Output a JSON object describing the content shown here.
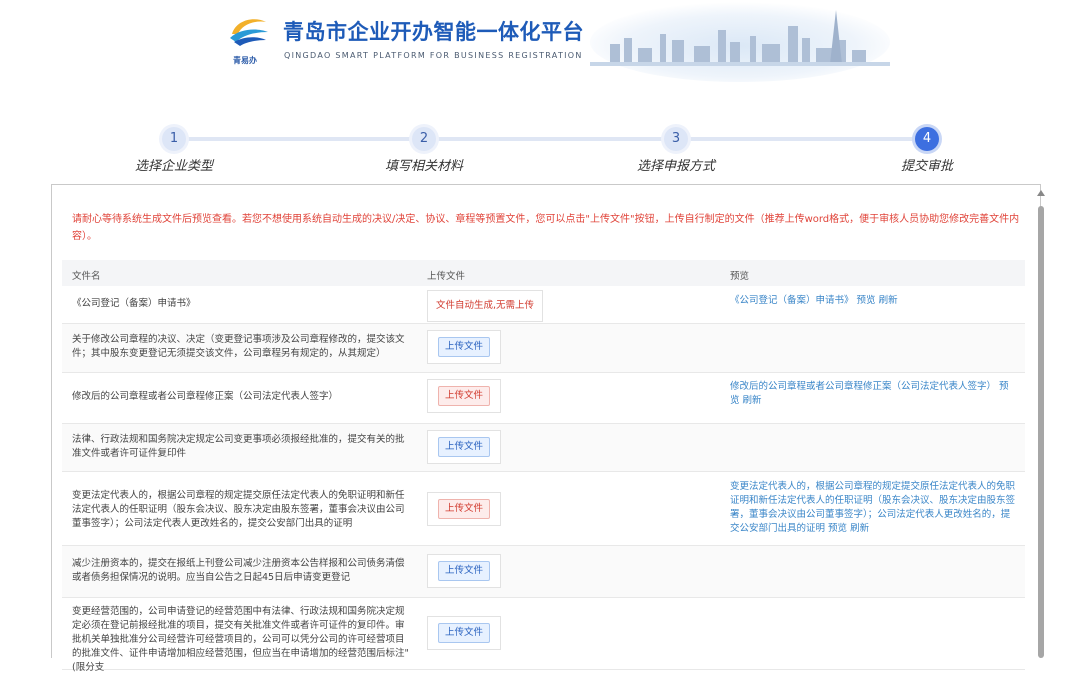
{
  "header": {
    "title": "青岛市企业开办智能一体化平台",
    "subtitle": "QINGDAO SMART PLATFORM FOR BUSINESS REGISTRATION",
    "logo_caption": "青易办",
    "brand_color": "#1e5bb8"
  },
  "stepper": {
    "current": 4,
    "steps": [
      {
        "num": "1",
        "label": "选择企业类型"
      },
      {
        "num": "2",
        "label": "填写相关材料"
      },
      {
        "num": "3",
        "label": "选择申报方式"
      },
      {
        "num": "4",
        "label": "提交审批"
      }
    ]
  },
  "notice": "请耐心等待系统生成文件后预览查看。若您不想使用系统自动生成的决议/决定、协议、章程等预置文件，您可以点击\"上传文件\"按钮，上传自行制定的文件（推荐上传word格式，便于审核人员协助您修改完善文件内容）。",
  "table": {
    "headers": {
      "name": "文件名",
      "upload": "上传文件",
      "preview": "预览"
    },
    "rows": [
      {
        "name": "《公司登记（备案）申请书》",
        "upload_type": "auto",
        "upload_text": "文件自动生成,无需上传",
        "preview_text": "《公司登记（备案）申请书》",
        "preview_action": "预览",
        "refresh_action": "刷新"
      },
      {
        "name": "关于修改公司章程的决议、决定（变更登记事项涉及公司章程修改的，提交该文件；其中股东变更登记无须提交该文件，公司章程另有规定的，从其规定）",
        "upload_type": "blue",
        "upload_text": "上传文件",
        "preview_text": "",
        "preview_action": "",
        "refresh_action": ""
      },
      {
        "name": "修改后的公司章程或者公司章程修正案（公司法定代表人签字）",
        "upload_type": "red",
        "upload_text": "上传文件",
        "preview_text": "修改后的公司章程或者公司章程修正案（公司法定代表人签字）",
        "preview_action": "预览",
        "refresh_action": "刷新"
      },
      {
        "name": "法律、行政法规和国务院决定规定公司变更事项必须报经批准的，提交有关的批准文件或者许可证件复印件",
        "upload_type": "blue",
        "upload_text": "上传文件",
        "preview_text": "",
        "preview_action": "",
        "refresh_action": ""
      },
      {
        "name": "变更法定代表人的，根据公司章程的规定提交原任法定代表人的免职证明和新任法定代表人的任职证明（股东会决议、股东决定由股东签署，董事会决议由公司董事签字）；公司法定代表人更改姓名的，提交公安部门出具的证明",
        "upload_type": "red",
        "upload_text": "上传文件",
        "preview_text": "变更法定代表人的，根据公司章程的规定提交原任法定代表人的免职证明和新任法定代表人的任职证明（股东会决议、股东决定由股东签署，董事会决议由公司董事签字）；公司法定代表人更改姓名的，提交公安部门出具的证明",
        "preview_action": "预览",
        "refresh_action": "刷新"
      },
      {
        "name": "减少注册资本的，提交在报纸上刊登公司减少注册资本公告样报和公司债务清偿或者债务担保情况的说明。应当自公告之日起45日后申请变更登记",
        "upload_type": "blue",
        "upload_text": "上传文件",
        "preview_text": "",
        "preview_action": "",
        "refresh_action": ""
      },
      {
        "name": "变更经营范围的，公司申请登记的经营范围中有法律、行政法规和国务院决定规定必须在登记前报经批准的项目，提交有关批准文件或者许可证件的复印件。审批机关单独批准分公司经营许可经营项目的，公司可以凭分公司的许可经营项目的批准文件、证件申请增加相应经营范围，但应当在申请增加的经营范围后标注\"(限分支",
        "upload_type": "blue",
        "upload_text": "上传文件",
        "preview_text": "",
        "preview_action": "",
        "refresh_action": ""
      }
    ]
  }
}
